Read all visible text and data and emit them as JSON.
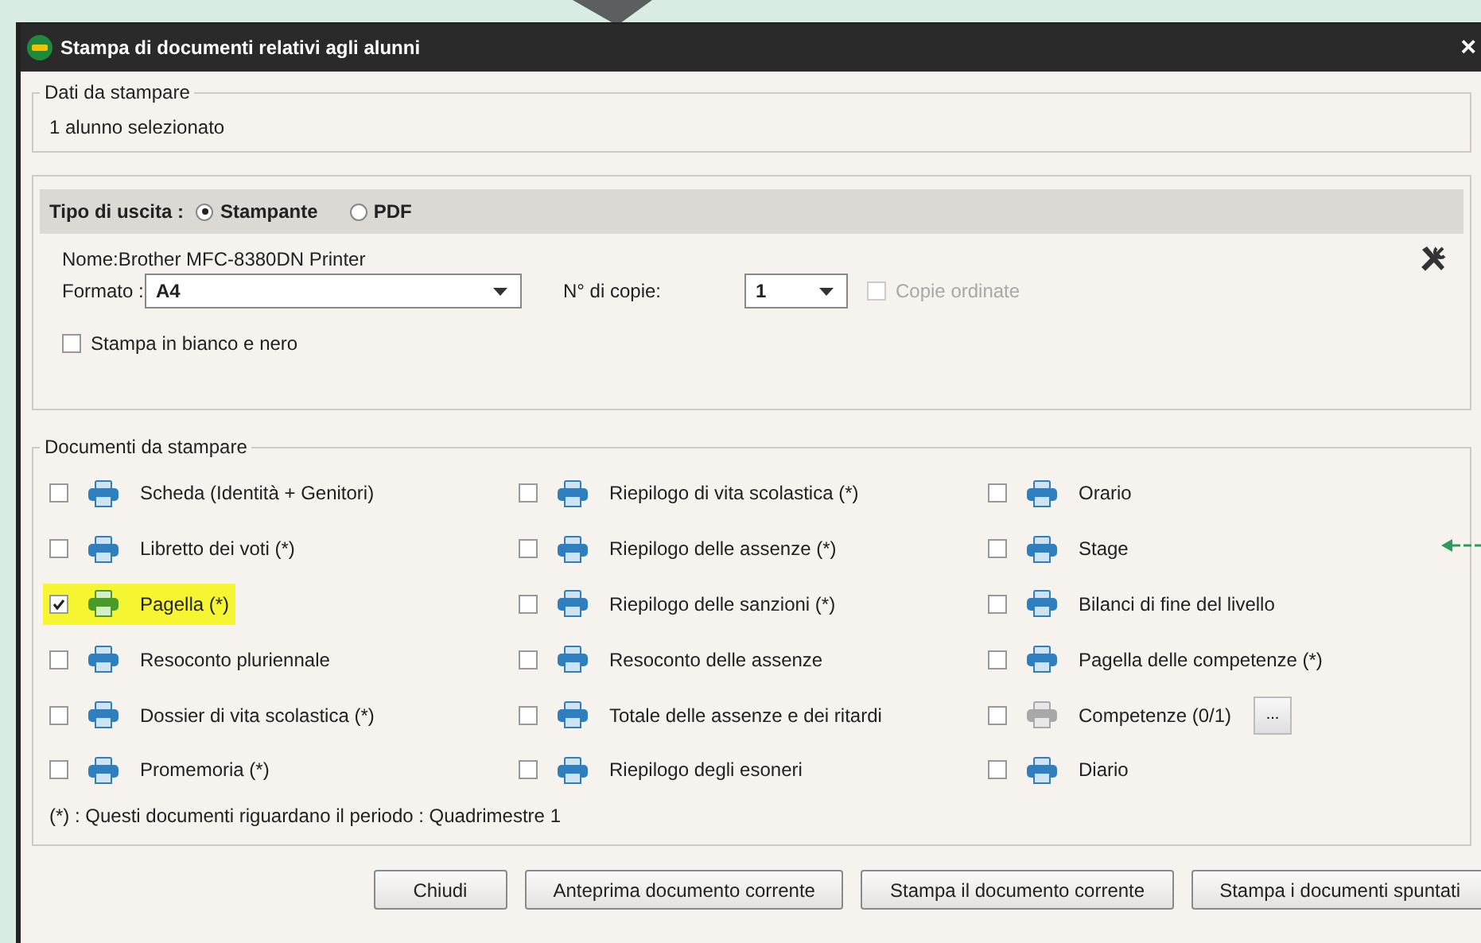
{
  "window": {
    "title": "Stampa di documenti relativi agli alunni",
    "close": "×"
  },
  "data_group": {
    "legend": "Dati da stampare",
    "text": "1 alunno selezionato"
  },
  "output": {
    "label": "Tipo di uscita :",
    "options": [
      {
        "label": "Stampante",
        "selected": true
      },
      {
        "label": "PDF",
        "selected": false
      }
    ]
  },
  "printer": {
    "name": "Nome:Brother MFC-8380DN Printer",
    "format_label": "Formato :",
    "format_value": "A4",
    "copies_label": "N° di copie:",
    "copies_value": "1",
    "collate": {
      "label": "Copie ordinate",
      "checked": false,
      "disabled": true
    },
    "bw": {
      "label": "Stampa in bianco e nero",
      "checked": false
    }
  },
  "documents": {
    "legend": "Documenti da stampare",
    "items": [
      {
        "label": "Scheda (Identità + Genitori)",
        "checked": false,
        "highlighted": false,
        "disabled": false
      },
      {
        "label": "Libretto dei voti (*)",
        "checked": false,
        "highlighted": false,
        "disabled": false
      },
      {
        "label": "Pagella (*)",
        "checked": true,
        "highlighted": true,
        "disabled": false
      },
      {
        "label": "Resoconto pluriennale",
        "checked": false,
        "highlighted": false,
        "disabled": false
      },
      {
        "label": "Dossier di vita scolastica (*)",
        "checked": false,
        "highlighted": false,
        "disabled": false
      },
      {
        "label": "Promemoria (*)",
        "checked": false,
        "highlighted": false,
        "disabled": false
      },
      {
        "label": "Riepilogo di vita scolastica (*)",
        "checked": false,
        "highlighted": false,
        "disabled": false
      },
      {
        "label": "Riepilogo delle assenze (*)",
        "checked": false,
        "highlighted": false,
        "disabled": false
      },
      {
        "label": "Riepilogo delle sanzioni (*)",
        "checked": false,
        "highlighted": false,
        "disabled": false
      },
      {
        "label": "Resoconto delle assenze",
        "checked": false,
        "highlighted": false,
        "disabled": false
      },
      {
        "label": "Totale delle assenze e dei ritardi",
        "checked": false,
        "highlighted": false,
        "disabled": false
      },
      {
        "label": "Riepilogo degli esoneri",
        "checked": false,
        "highlighted": false,
        "disabled": false
      },
      {
        "label": "Orario",
        "checked": false,
        "highlighted": false,
        "disabled": false
      },
      {
        "label": "Stage",
        "checked": false,
        "highlighted": false,
        "disabled": false
      },
      {
        "label": "Bilanci di fine del livello",
        "checked": false,
        "highlighted": false,
        "disabled": false
      },
      {
        "label": "Pagella delle competenze (*)",
        "checked": false,
        "highlighted": false,
        "disabled": false
      },
      {
        "label": "Competenze (0/1)",
        "checked": false,
        "highlighted": false,
        "disabled": true,
        "more_button": "..."
      },
      {
        "label": "Diario",
        "checked": false,
        "highlighted": false,
        "disabled": false
      }
    ],
    "note": "(*) : Questi documenti riguardano il periodo : Quadrimestre 1"
  },
  "buttons": [
    "Chiudi",
    "Anteprima documento corrente",
    "Stampa il documento corrente",
    "Stampa i documenti spuntati"
  ]
}
